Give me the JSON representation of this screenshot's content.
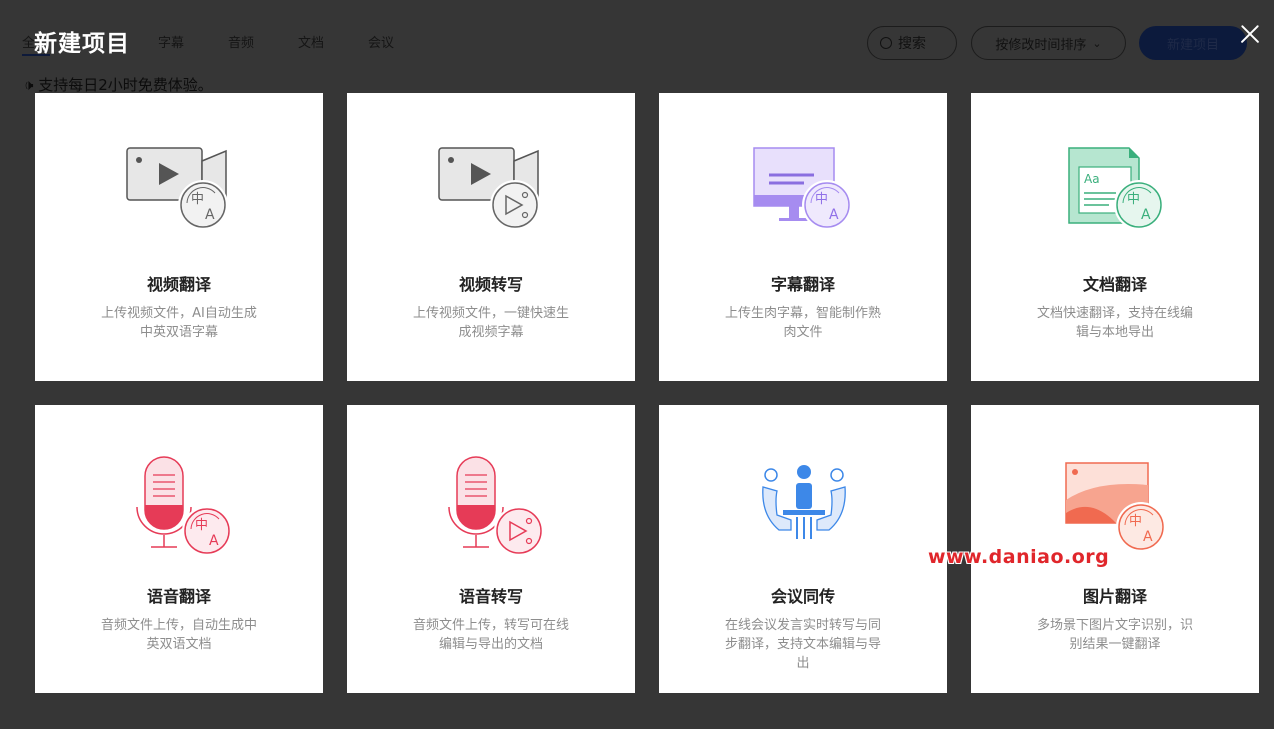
{
  "background_page": {
    "tabs": [
      "全",
      "字幕",
      "音频",
      "文档",
      "会议"
    ],
    "notice": "🕩 支持每日2小时免费体验。",
    "search_label": "搜索",
    "sort_label": "按修改时间排序",
    "new_project_label": "新建项目"
  },
  "dialog": {
    "title": "新建项目",
    "cards": [
      {
        "title": "视频翻译",
        "desc": "上传视频文件，AI自动生成中英双语字幕",
        "icon": "video-translate-icon"
      },
      {
        "title": "视频转写",
        "desc": "上传视频文件，一键快速生成视频字幕",
        "icon": "video-transcribe-icon"
      },
      {
        "title": "字幕翻译",
        "desc": "上传生肉字幕，智能制作熟肉文件",
        "icon": "subtitle-translate-icon"
      },
      {
        "title": "文档翻译",
        "desc": "文档快速翻译，支持在线编辑与本地导出",
        "icon": "document-translate-icon"
      },
      {
        "title": "语音翻译",
        "desc": "音频文件上传，自动生成中英双语文档",
        "icon": "audio-translate-icon"
      },
      {
        "title": "语音转写",
        "desc": "音频文件上传，转写可在线编辑与导出的文档",
        "icon": "audio-transcribe-icon"
      },
      {
        "title": "会议同传",
        "desc": "在线会议发言实时转写与同步翻译，支持文本编辑与导出",
        "icon": "meeting-interpret-icon"
      },
      {
        "title": "图片翻译",
        "desc": "多场景下图片文字识别，识别结果一键翻译",
        "icon": "image-translate-icon"
      }
    ]
  },
  "watermark": "www.daniao.org",
  "colors": {
    "overlay": "#363636",
    "card_bg": "#ffffff",
    "purple": "#a68cf0",
    "green": "#3aaf7c",
    "red": "#e63b57",
    "blue": "#3d88e8",
    "orange": "#f06a50"
  }
}
